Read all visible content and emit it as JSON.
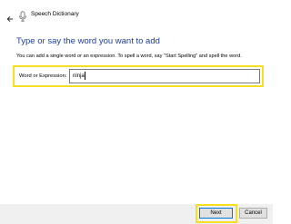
{
  "window": {
    "title": "Speech Dictionary",
    "back_icon": "back-arrow-icon",
    "app_icon": "microphone-icon"
  },
  "main": {
    "heading": "Type or say the word you want to add",
    "instructions": "You can add a single word or an expression. To spell a word, say \"Start Spelling\" and spell the word.",
    "field_label": "Word or Expression:",
    "field_value": "ninja"
  },
  "buttons": {
    "next_label": "Next",
    "cancel_label": "Cancel"
  },
  "colors": {
    "heading": "#1f3f9a",
    "highlight": "#f5de23",
    "footer": "#f0f0f0",
    "primary_border": "#0078d7"
  }
}
